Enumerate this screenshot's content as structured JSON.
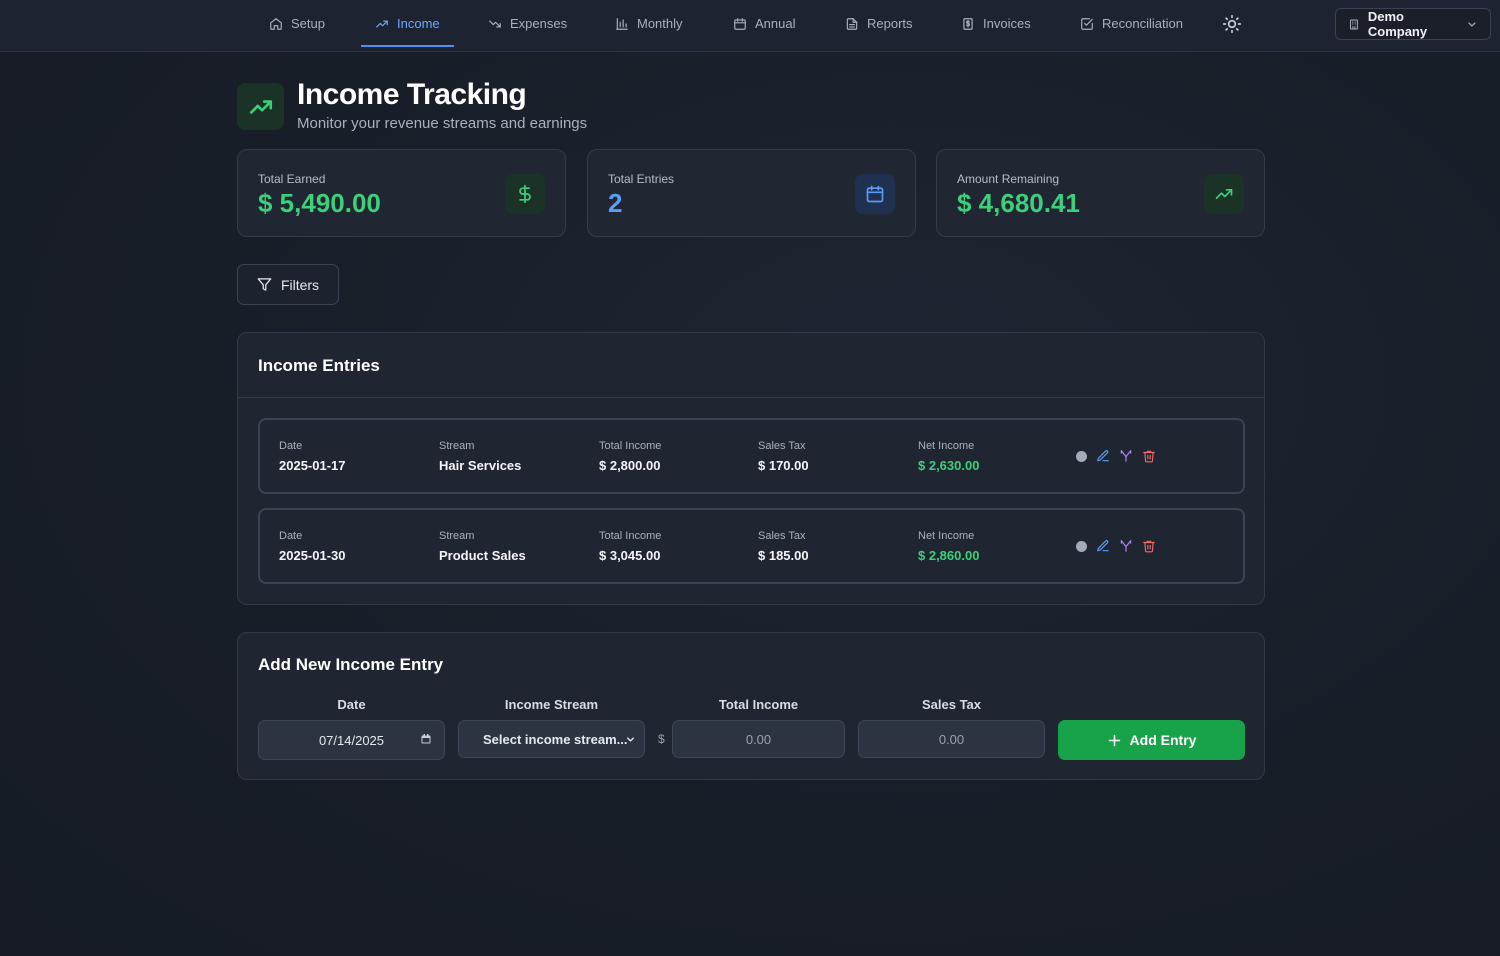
{
  "nav": {
    "items": [
      {
        "label": "Setup",
        "icon": "home-icon"
      },
      {
        "label": "Income",
        "icon": "trending-up-icon"
      },
      {
        "label": "Expenses",
        "icon": "trending-down-icon"
      },
      {
        "label": "Monthly",
        "icon": "bar-chart-icon"
      },
      {
        "label": "Annual",
        "icon": "calendar-icon"
      },
      {
        "label": "Reports",
        "icon": "file-text-icon"
      },
      {
        "label": "Invoices",
        "icon": "receipt-icon"
      },
      {
        "label": "Reconciliation",
        "icon": "check-square-icon"
      }
    ],
    "active": "Income",
    "theme_icon": "sun-icon",
    "company_label": "Demo Company"
  },
  "header": {
    "title": "Income Tracking",
    "subtitle": "Monitor your revenue streams and earnings"
  },
  "stats": [
    {
      "label": "Total Earned",
      "value": "$ 5,490.00",
      "color": "#3dd07a",
      "icon": "dollar-icon"
    },
    {
      "label": "Total Entries",
      "value": "2",
      "color": "#5b9df5",
      "icon": "calendar-icon"
    },
    {
      "label": "Amount Remaining",
      "value": "$ 4,680.41",
      "color": "#3dd07a",
      "icon": "trending-up-icon"
    }
  ],
  "filters": {
    "label": "Filters"
  },
  "entries": {
    "title": "Income Entries",
    "column_labels": {
      "date": "Date",
      "stream": "Stream",
      "total_income": "Total Income",
      "sales_tax": "Sales Tax",
      "net_income": "Net Income"
    },
    "rows": [
      {
        "date": "2025-01-17",
        "stream": "Hair Services",
        "total_income": "$ 2,800.00",
        "sales_tax": "$ 170.00",
        "net_income": "$ 2,630.00"
      },
      {
        "date": "2025-01-30",
        "stream": "Product Sales",
        "total_income": "$ 3,045.00",
        "sales_tax": "$ 185.00",
        "net_income": "$ 2,860.00"
      }
    ]
  },
  "add_form": {
    "title": "Add New Income Entry",
    "date_label": "Date",
    "date_value": "07/14/2025",
    "stream_label": "Income Stream",
    "stream_value": "Select income stream...",
    "total_label": "Total Income",
    "currency": "$",
    "total_placeholder": "0.00",
    "tax_label": "Sales Tax",
    "tax_placeholder": "0.00",
    "submit_label": "Add Entry"
  },
  "colors": {
    "accent_green": "#3dd07a",
    "accent_blue": "#5b9df5",
    "button_green": "#18a34a",
    "danger": "#f06a6a",
    "purple": "#b085f5"
  }
}
